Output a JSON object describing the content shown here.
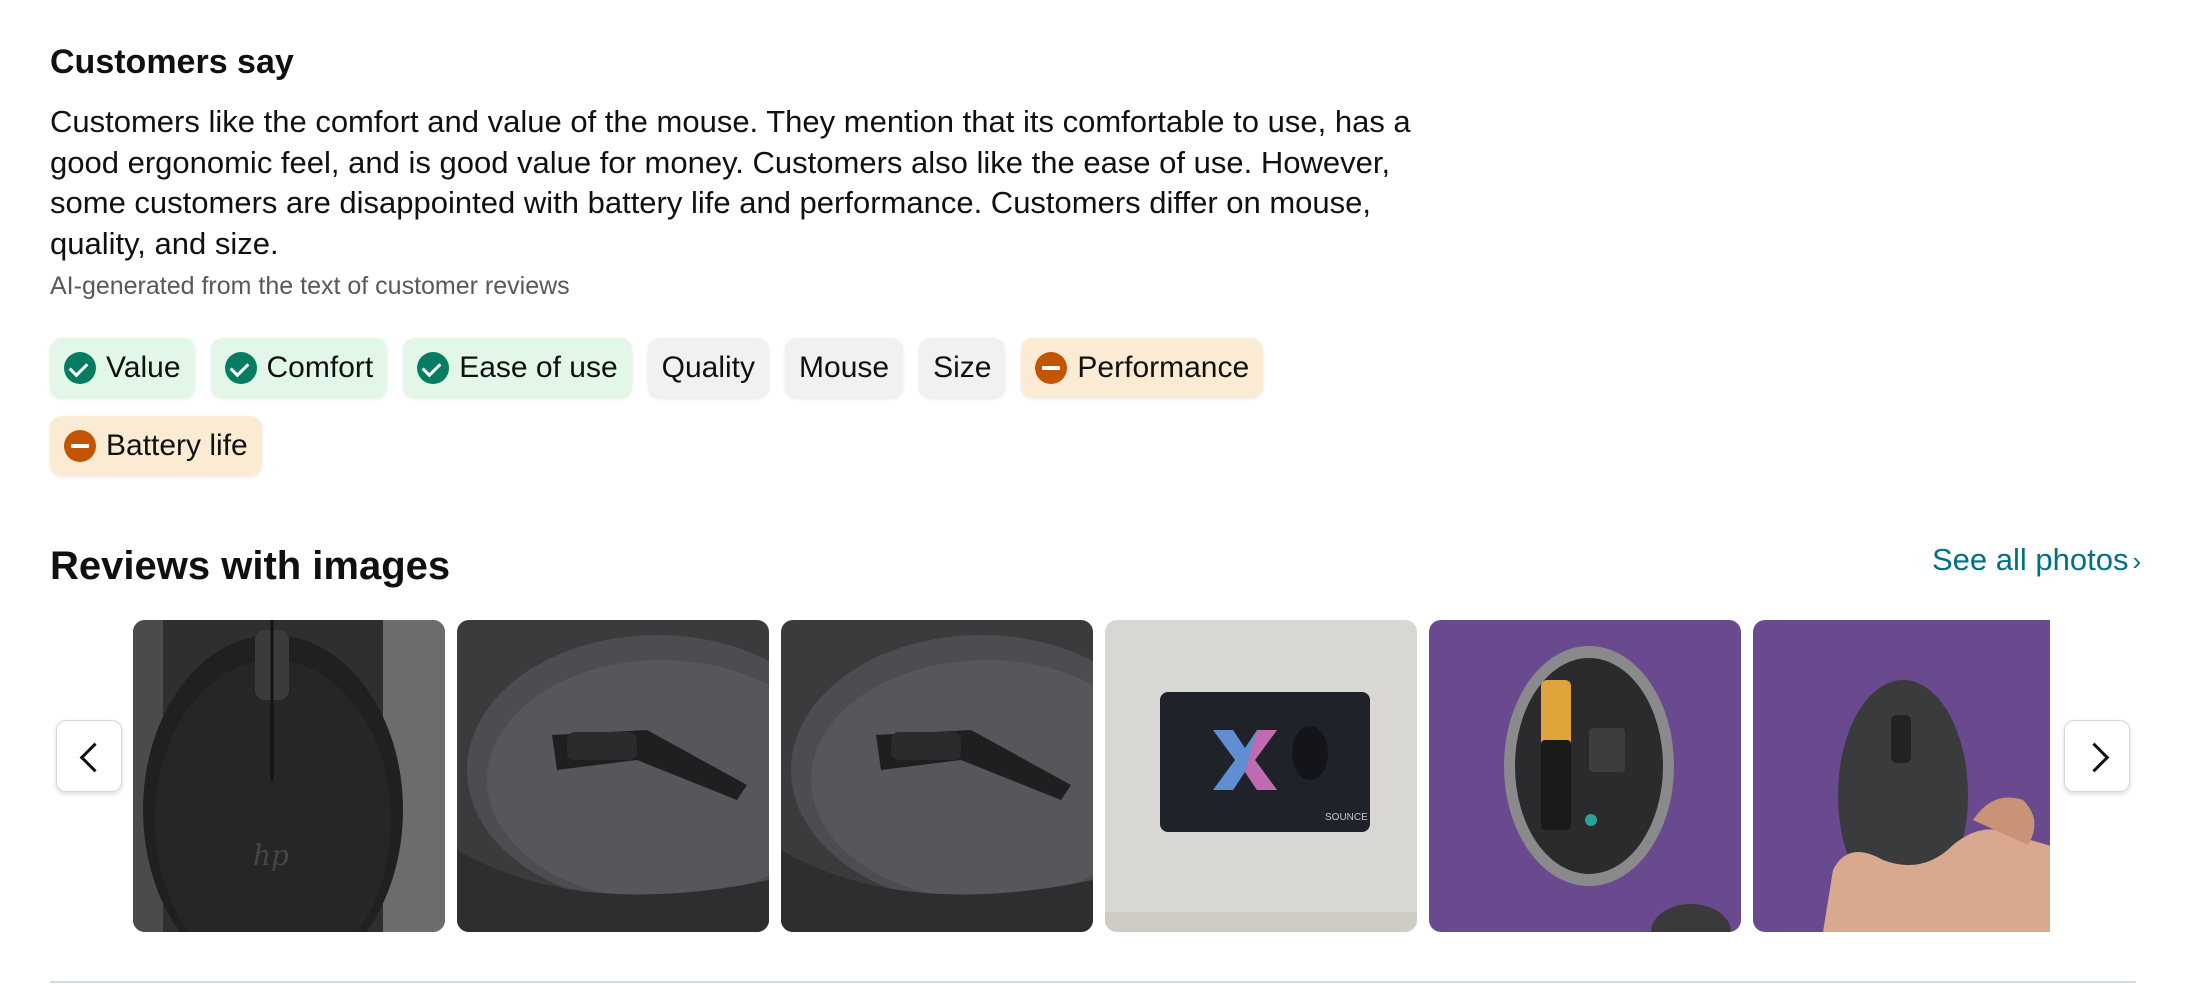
{
  "customers_say": {
    "title": "Customers say",
    "summary": "Customers like the comfort and value of the mouse. They mention that its comfortable to use, has a good ergonomic feel, and is good value for money. Customers also like the ease of use. However, some customers are disappointed with battery life and performance. Customers differ on mouse, quality, and size.",
    "ai_note": "AI-generated from the text of customer reviews",
    "aspects": [
      {
        "label": "Value",
        "sentiment": "positive",
        "icon": "check-circle-icon"
      },
      {
        "label": "Comfort",
        "sentiment": "positive",
        "icon": "check-circle-icon"
      },
      {
        "label": "Ease of use",
        "sentiment": "positive",
        "icon": "check-circle-icon"
      },
      {
        "label": "Quality",
        "sentiment": "neutral",
        "icon": ""
      },
      {
        "label": "Mouse",
        "sentiment": "neutral",
        "icon": ""
      },
      {
        "label": "Size",
        "sentiment": "neutral",
        "icon": ""
      },
      {
        "label": "Performance",
        "sentiment": "negative",
        "icon": "minus-circle-icon"
      },
      {
        "label": "Battery life",
        "sentiment": "negative",
        "icon": "minus-circle-icon"
      }
    ]
  },
  "reviews_with_images": {
    "title": "Reviews with images",
    "see_all_label": "See all photos",
    "see_all_icon": "chevron-right-icon",
    "carousel": {
      "prev_icon": "chevron-left-icon",
      "next_icon": "chevron-right-icon",
      "images": [
        "black mouse top view",
        "black mouse angled close-up",
        "black mouse angled close-up",
        "mouse on mousepad",
        "mouse battery compartment on purple cloth",
        "hand holding mouse on purple cloth"
      ]
    }
  },
  "colors": {
    "positive_bg": "#e3f7e8",
    "positive_icon": "#067d62",
    "neutral_bg": "#f0f2f2",
    "negative_bg": "#fcebd3",
    "negative_icon": "#c45500",
    "link": "#007185",
    "text": "#0f1111",
    "muted": "#565959"
  }
}
